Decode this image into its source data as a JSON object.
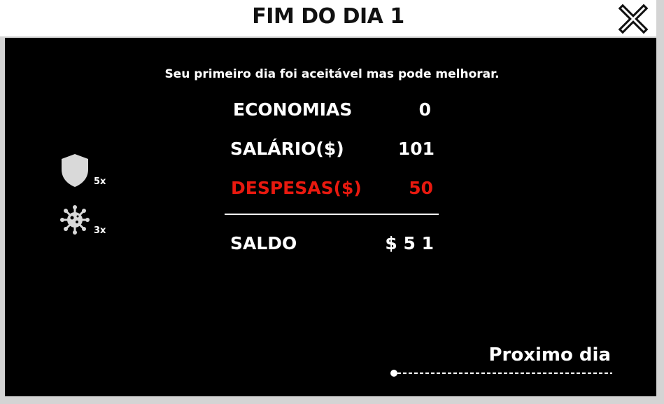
{
  "header": {
    "title": "FIM DO DIA 1",
    "close_icon": "close-x-icon"
  },
  "summary": {
    "message": "Seu primeiro dia foi aceitável mas pode melhorar.",
    "rows": [
      {
        "label": "ECONOMIAS",
        "value": "0"
      },
      {
        "label": "SALÁRIO($)",
        "value": "101"
      },
      {
        "label": "DESPESAS($)",
        "value": "50"
      }
    ],
    "total": {
      "label": "SALDO",
      "value": "$ 5 1"
    }
  },
  "inventory": [
    {
      "icon": "shield-icon",
      "count": "5x"
    },
    {
      "icon": "virus-icon",
      "count": "3x"
    }
  ],
  "navigation": {
    "next_label": "Proximo dia"
  },
  "colors": {
    "background": "#000000",
    "header_bg": "#ffffff",
    "text": "#ffffff",
    "expense": "#e8190f",
    "icon": "#d9d9d9"
  }
}
